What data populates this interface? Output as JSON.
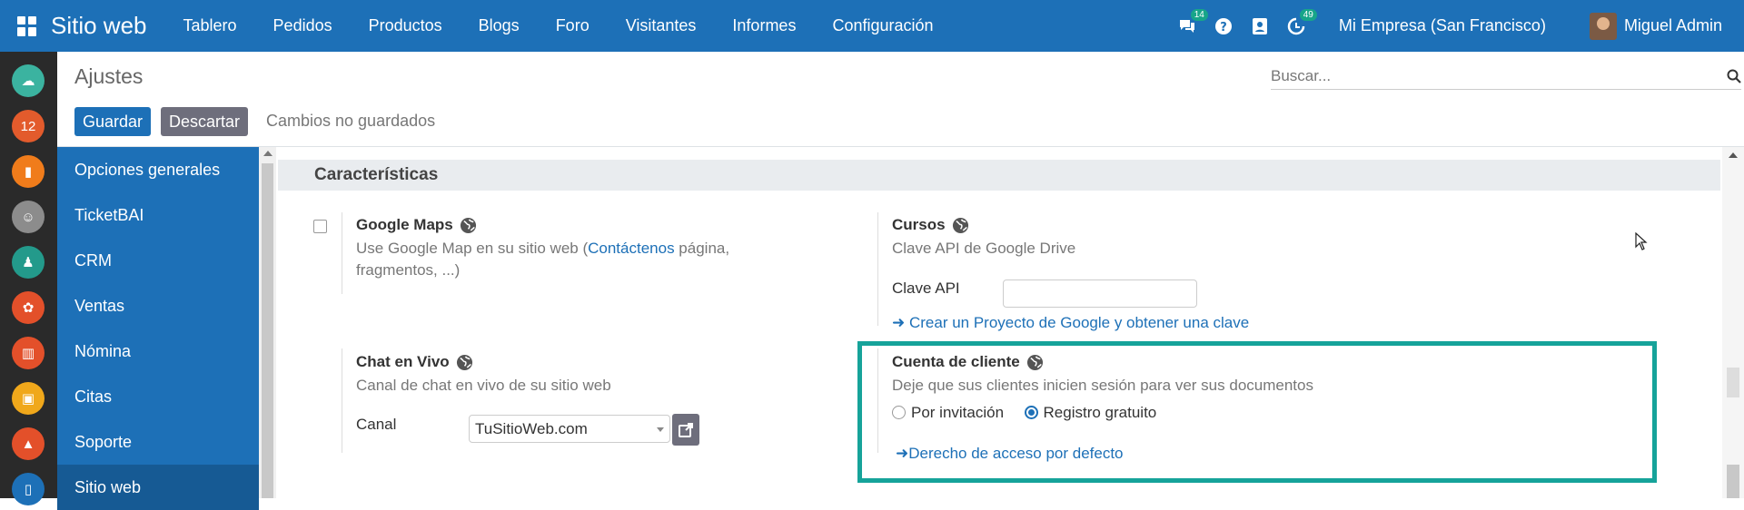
{
  "navbar": {
    "brand": "Sitio web",
    "menu": [
      "Tablero",
      "Pedidos",
      "Productos",
      "Blogs",
      "Foro",
      "Visitantes",
      "Informes",
      "Configuración"
    ],
    "chat_badge": "14",
    "activity_badge": "49",
    "company": "Mi Empresa (San Francisco)",
    "user": "Miguel Admin",
    "icons": [
      "apps-grid-icon",
      "chat-icon",
      "help-icon",
      "contacts-icon",
      "activity-clock-icon"
    ]
  },
  "appbar": {
    "apps": [
      {
        "name": "discuss-app-icon",
        "color": "#3bb3a0",
        "glyph": "☁"
      },
      {
        "name": "calendar-app-icon",
        "color": "#e35b2c",
        "glyph": "12"
      },
      {
        "name": "notes-app-icon",
        "color": "#f07c1b",
        "glyph": "▮"
      },
      {
        "name": "contacts-app-icon",
        "color": "#8c8c8c",
        "glyph": "☺"
      },
      {
        "name": "crm-app-icon",
        "color": "#239a8b",
        "glyph": "♟"
      },
      {
        "name": "sales-app-icon",
        "color": "#e3502a",
        "glyph": "✿"
      },
      {
        "name": "reports-app-icon",
        "color": "#e3502a",
        "glyph": "▥"
      },
      {
        "name": "employees-app-icon",
        "color": "#f0a81b",
        "glyph": "▣"
      },
      {
        "name": "helpdesk-app-icon",
        "color": "#e3502a",
        "glyph": "▲"
      },
      {
        "name": "pos-app-icon",
        "color": "#1d70b7",
        "glyph": "▯"
      }
    ]
  },
  "control_panel": {
    "title": "Ajustes",
    "search_placeholder": "Buscar...",
    "save_label": "Guardar",
    "discard_label": "Descartar",
    "unsaved_label": "Cambios no guardados"
  },
  "settings_sidebar": {
    "items": [
      "Opciones generales",
      "TicketBAI",
      "CRM",
      "Ventas",
      "Nómina",
      "Citas",
      "Soporte",
      "Sitio web"
    ],
    "active": "Sitio web"
  },
  "section": {
    "title": "Características"
  },
  "google_maps": {
    "title": "Google Maps",
    "desc_before": "Use Google Map en su sitio web (",
    "desc_link": "Contáctenos",
    "desc_after": " página,",
    "desc_line2": "fragmentos, ...)",
    "checked": false
  },
  "cursos": {
    "title": "Cursos",
    "desc": "Clave API de Google Drive",
    "api_label": "Clave API",
    "api_value": "",
    "link": "Crear un Proyecto de Google y obtener una clave"
  },
  "live_chat": {
    "title": "Chat en Vivo",
    "desc": "Canal de chat en vivo de su sitio web",
    "channel_label": "Canal",
    "channel_value": "TuSitioWeb.com"
  },
  "customer_account": {
    "title": "Cuenta de cliente",
    "desc": "Deje que sus clientes inicien sesión para ver sus documentos",
    "option_invite": "Por invitación",
    "option_free": "Registro gratuito",
    "selected": "Registro gratuito",
    "link": "Derecho de acceso por defecto"
  },
  "colors": {
    "brand_blue": "#1d70b7",
    "highlight_teal": "#16a39a",
    "discard_gray": "#6e6e7c"
  }
}
